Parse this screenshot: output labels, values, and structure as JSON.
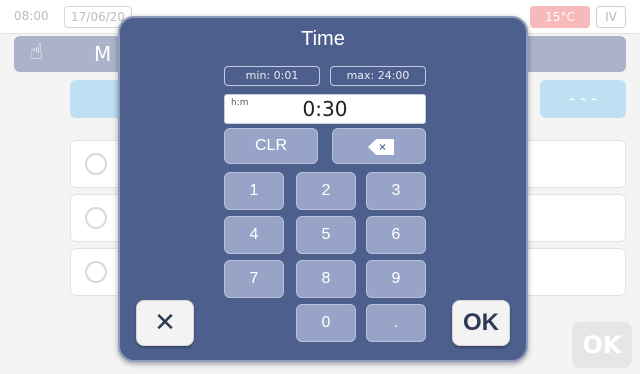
{
  "background": {
    "time": "08:00",
    "date": "17/06/20",
    "temperature": "15°C",
    "mode_badge": "IV",
    "nav_letter": "M",
    "right_tab": "- - -",
    "ok_label": "OK"
  },
  "dialog": {
    "title": "Time",
    "min_label": "min: 0:01",
    "max_label": "max: 24:00",
    "unit_label": "h:m",
    "value": "0:30",
    "clr_label": "CLR",
    "keys": [
      "1",
      "2",
      "3",
      "4",
      "5",
      "6",
      "7",
      "8",
      "9",
      "0",
      "."
    ],
    "cancel_label": "✕",
    "ok_label": "OK"
  },
  "colors": {
    "dialog_bg": "#4d5f8c",
    "key_bg": "#97a4c7",
    "background_nav": "#aab3c9"
  },
  "icons": {
    "backspace": "backspace-icon",
    "cancel": "close-icon",
    "hand": "hand-icon"
  }
}
